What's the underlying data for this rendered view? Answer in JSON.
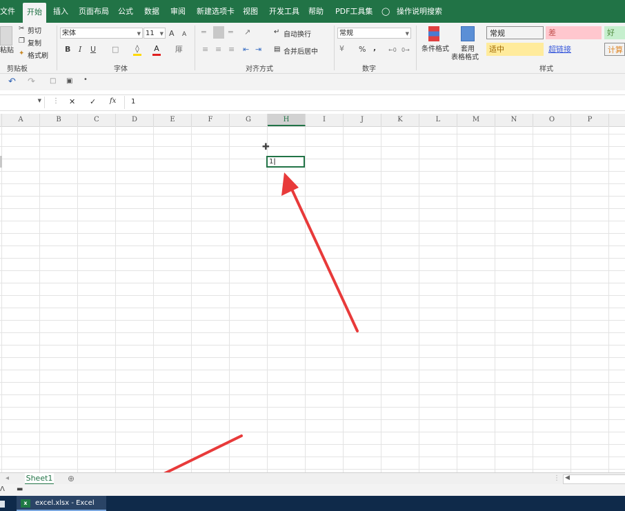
{
  "tabs": [
    {
      "label": "文件"
    },
    {
      "label": "开始"
    },
    {
      "label": "插入"
    },
    {
      "label": "页面布局"
    },
    {
      "label": "公式"
    },
    {
      "label": "数据"
    },
    {
      "label": "审阅"
    },
    {
      "label": "新建选项卡"
    },
    {
      "label": "视图"
    },
    {
      "label": "开发工具"
    },
    {
      "label": "帮助"
    },
    {
      "label": "PDF工具集"
    }
  ],
  "active_tab": "开始",
  "search_hint": "操作说明搜索",
  "clipboard": {
    "paste_label": "粘贴",
    "cut_label": "剪切",
    "copy_label": "复制",
    "format_painter_label": "格式刷",
    "group_label": "剪贴板"
  },
  "font": {
    "font_name": "宋体",
    "font_size": "11",
    "bold": "B",
    "italic": "I",
    "underline": "U",
    "grow": "A",
    "shrink": "A",
    "font_color_glyph": "A",
    "group_label": "字体"
  },
  "alignment": {
    "wrap_label": "自动换行",
    "merge_label": "合并后居中",
    "group_label": "对齐方式"
  },
  "number": {
    "format": "常规",
    "percent": "%",
    "comma": ",",
    "group_label": "数字"
  },
  "styles": {
    "conditional_label": "条件格式",
    "table_label_1": "套用",
    "table_label_2": "表格格式",
    "cells": [
      {
        "label": "常规",
        "bg": "#ffffff",
        "color": "#777777"
      },
      {
        "label": "差",
        "bg": "#ffc7ce",
        "color": "#c0504d"
      },
      {
        "label": "好",
        "bg": "#c6efce",
        "color": "#4f8a3c"
      },
      {
        "label": "适中",
        "bg": "#ffeb9c",
        "color": "#9c6500"
      },
      {
        "label": "超链接",
        "bg": "#f3f3f3",
        "color": "#3b5bdb"
      },
      {
        "label": "计算",
        "bg": "#f2f2f2",
        "color": "#e08a2c"
      }
    ],
    "group_label": "样式"
  },
  "formula_bar": {
    "fx": "fx",
    "cancel": "✕",
    "enter": "✓",
    "value": "1"
  },
  "columns": [
    "A",
    "B",
    "C",
    "D",
    "E",
    "F",
    "G",
    "H",
    "I",
    "J",
    "K",
    "L",
    "M",
    "N",
    "O",
    "P"
  ],
  "selected_column": "H",
  "active_cell_value": "1",
  "sheet_tab": "Sheet1",
  "taskbar_item": "excel.xlsx - Excel",
  "accent": "#217346",
  "annotation_color": "#e83a3a"
}
